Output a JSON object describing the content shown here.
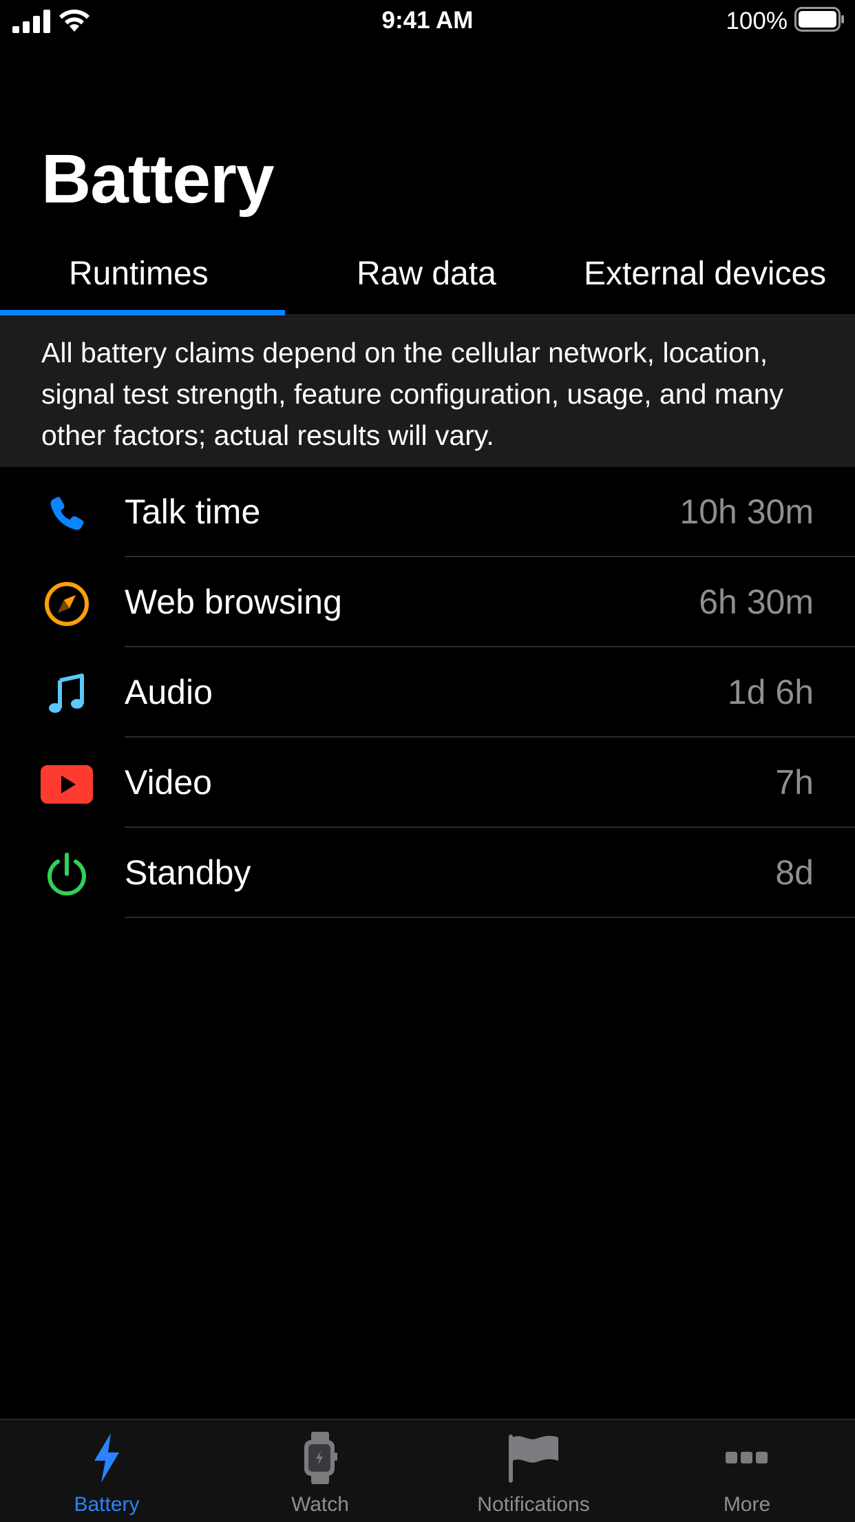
{
  "status_bar": {
    "time": "9:41 AM",
    "battery_percent": "100%"
  },
  "page_title": "Battery",
  "tabs": [
    {
      "label": "Runtimes",
      "active": true
    },
    {
      "label": "Raw data",
      "active": false
    },
    {
      "label": "External devices",
      "active": false
    }
  ],
  "disclaimer": "All battery claims depend on the cellular network, location, signal test strength, feature configuration, usage, and many other factors; actual results will vary.",
  "runtimes": [
    {
      "label": "Talk time",
      "value": "10h 30m",
      "icon": "phone-icon",
      "color": "#0a84ff"
    },
    {
      "label": "Web browsing",
      "value": "6h 30m",
      "icon": "compass-icon",
      "color": "#ff9f0a"
    },
    {
      "label": "Audio",
      "value": "1d 6h",
      "icon": "music-note-icon",
      "color": "#5ac8fa"
    },
    {
      "label": "Video",
      "value": "7h",
      "icon": "play-video-icon",
      "color": "#ff3b30"
    },
    {
      "label": "Standby",
      "value": "8d",
      "icon": "power-icon",
      "color": "#30d158"
    }
  ],
  "tab_bar": [
    {
      "label": "Battery",
      "icon": "bolt-icon",
      "active": true
    },
    {
      "label": "Watch",
      "icon": "watch-icon",
      "active": false
    },
    {
      "label": "Notifications",
      "icon": "flag-icon",
      "active": false
    },
    {
      "label": "More",
      "icon": "more-dots-icon",
      "active": false
    }
  ],
  "colors": {
    "accent": "#0a84ff",
    "background": "#000000",
    "secondary_text": "#8e8e93"
  }
}
